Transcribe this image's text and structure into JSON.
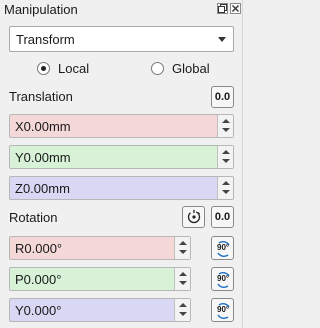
{
  "window": {
    "title": "Manipulation"
  },
  "mode": {
    "selected": "Transform"
  },
  "frame": {
    "local_label": "Local",
    "global_label": "Global",
    "selected": "Local"
  },
  "translation": {
    "label": "Translation",
    "reset_label": "0.0",
    "x": "X0.00mm",
    "y": "Y0.00mm",
    "z": "Z0.00mm"
  },
  "rotation": {
    "label": "Rotation",
    "reset_label": "0.0",
    "r": "R0.000°",
    "p": "P0.000°",
    "yaw": "Y0.000°",
    "rotate90_label": "90°"
  },
  "colors": {
    "x_axis": "#f4d8d8",
    "y_axis": "#d8f2d8",
    "z_axis": "#d8d8f4"
  },
  "icons": {
    "float": "float-window-icon",
    "close": "close-icon",
    "pick": "pick-rotation-center-icon",
    "rotate90": "rotate-90-icon"
  }
}
